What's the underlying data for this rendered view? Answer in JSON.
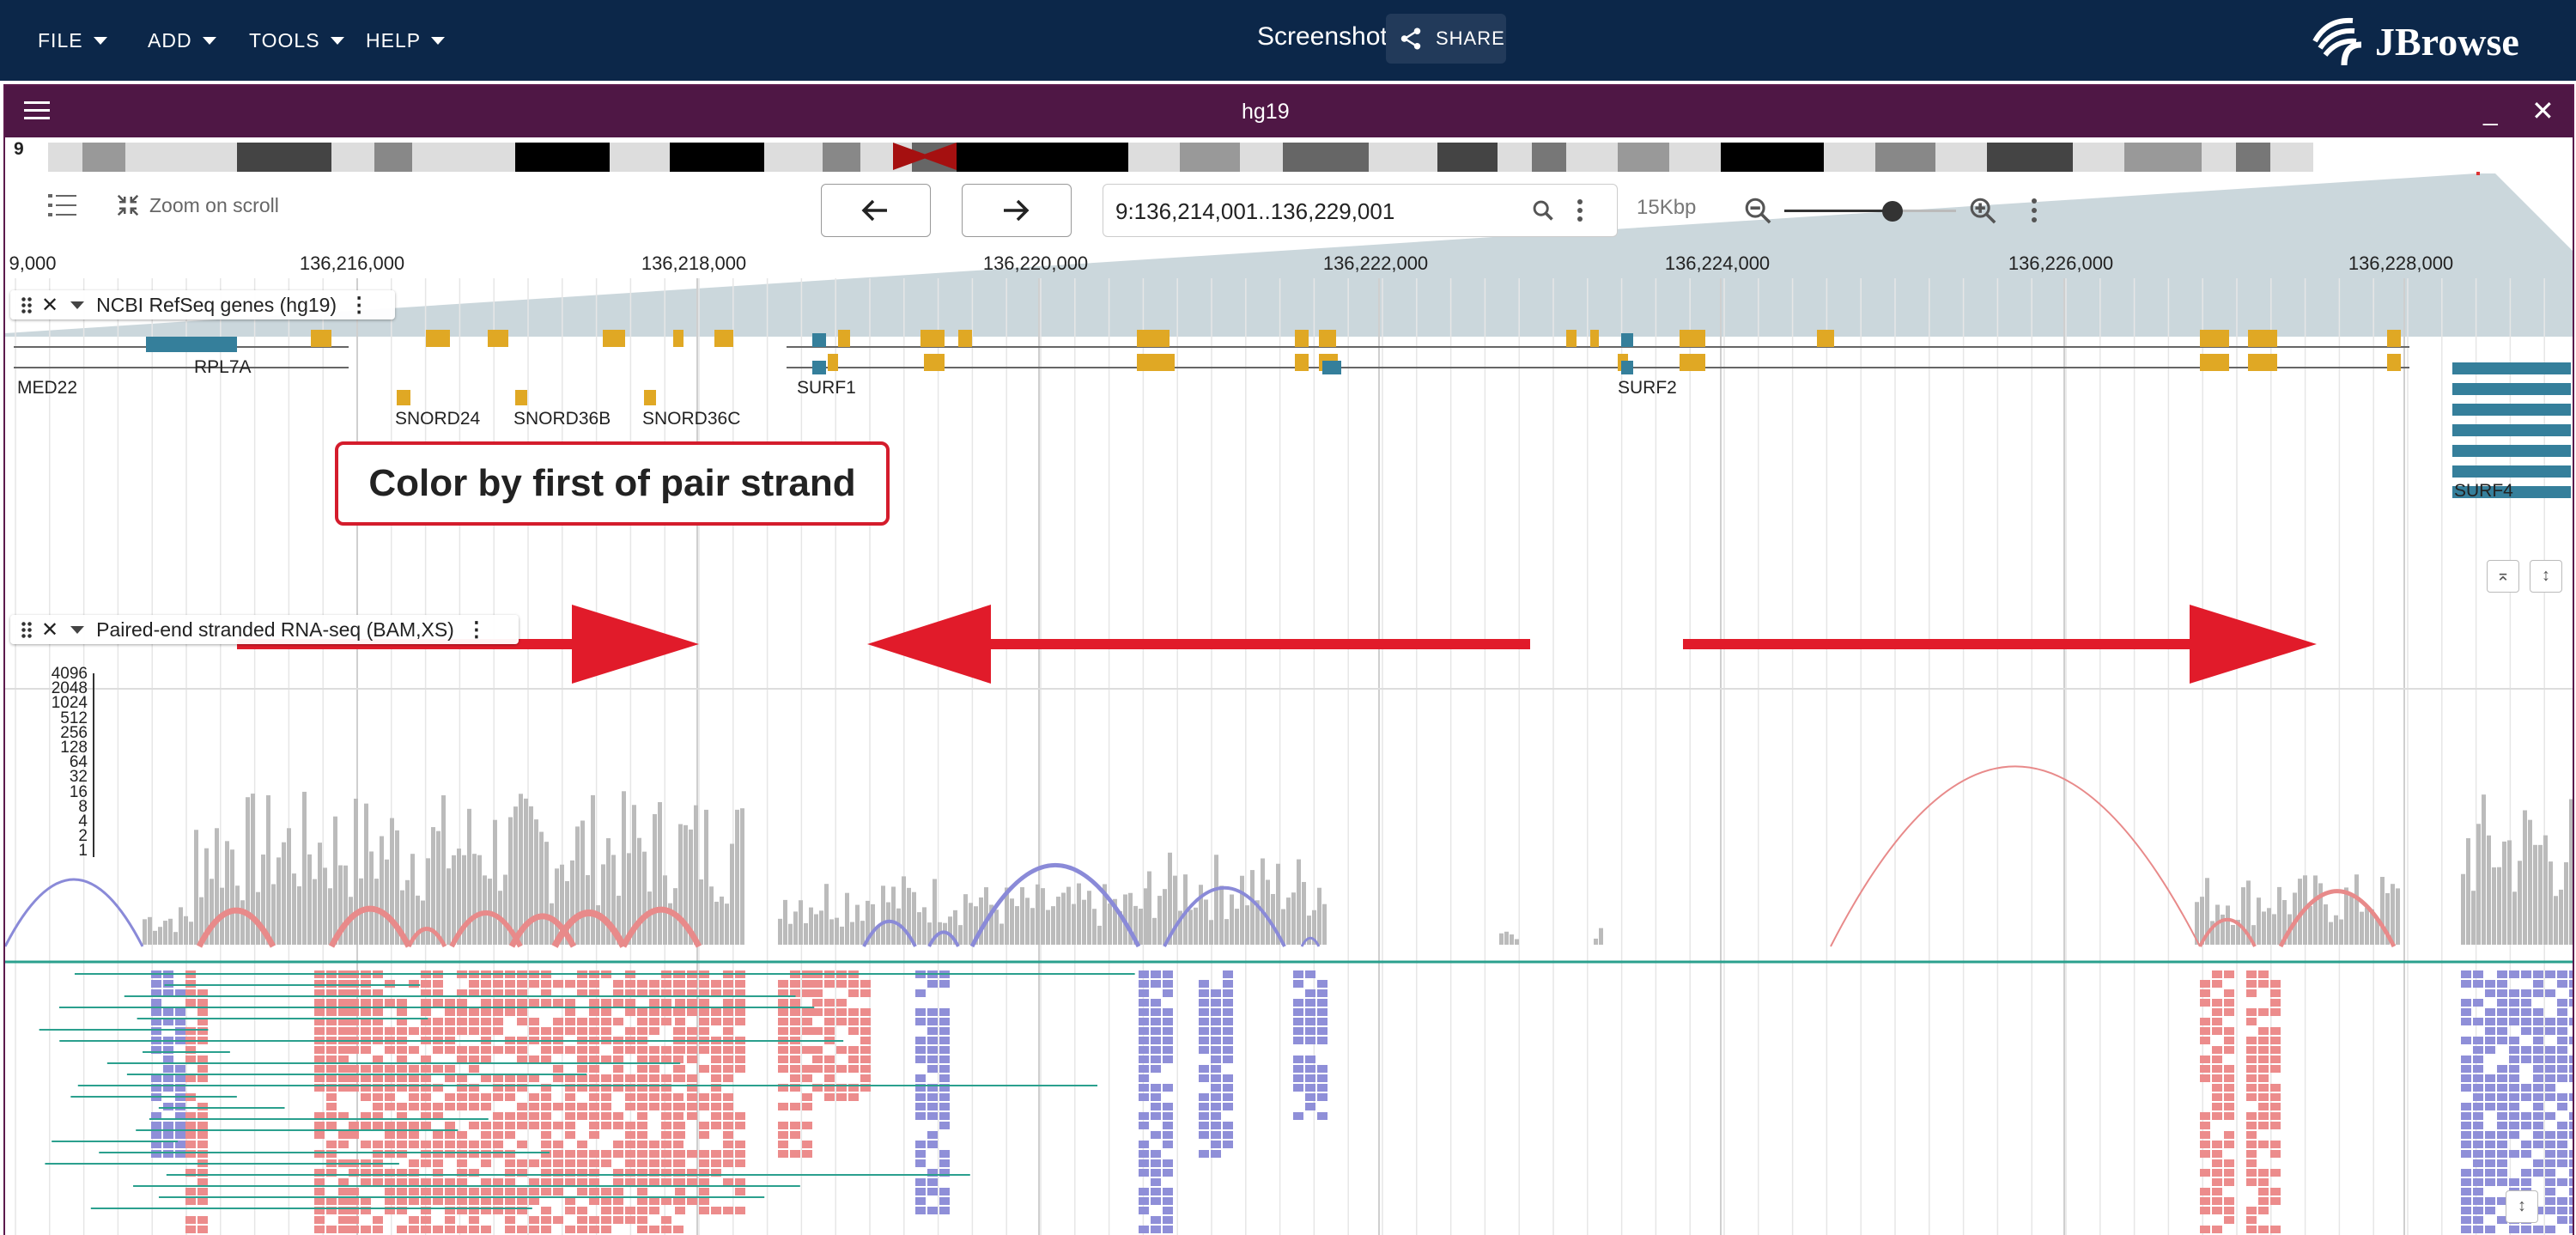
{
  "appbar": {
    "menus": [
      "FILE",
      "ADD",
      "TOOLS",
      "HELP"
    ],
    "session_title": "Screenshot",
    "share_label": "SHARE",
    "logo_text": "JBrowse"
  },
  "view": {
    "title": "hg19",
    "chromosome": "9",
    "zoom_on_scroll_label": "Zoom on scroll",
    "locus": "9:136,214,001..136,229,001",
    "span": "15Kbp",
    "ruler_ticks": [
      "9,000",
      "136,216,000",
      "136,218,000",
      "136,220,000",
      "136,222,000",
      "136,224,000",
      "136,226,000",
      "136,228,000"
    ]
  },
  "tracks": {
    "genes": {
      "label": "NCBI RefSeq genes (hg19)",
      "gene_names": [
        "MED22",
        "RPL7A",
        "SNORD24",
        "SNORD36B",
        "SNORD36C",
        "SURF1",
        "SURF2",
        "SURF4"
      ]
    },
    "annotation": "Color by first of pair strand",
    "rnaseq": {
      "label": "Paired-end stranded RNA-seq (BAM,XS)",
      "coverage_ticks": [
        "4096",
        "2048",
        "1024",
        "512",
        "256",
        "128",
        "64",
        "32",
        "16",
        "8",
        "4",
        "2",
        "1"
      ]
    }
  },
  "colors": {
    "appbar_bg": "#0c2749",
    "view_bar_bg": "#4f1745",
    "forward_read": "#ec8c8c",
    "reverse_read": "#8f8fd8",
    "gene_exon": "#e0a824",
    "gene_utr": "#357f9b",
    "coverage": "#bbbbbb",
    "arrow": "#e11b2a"
  }
}
